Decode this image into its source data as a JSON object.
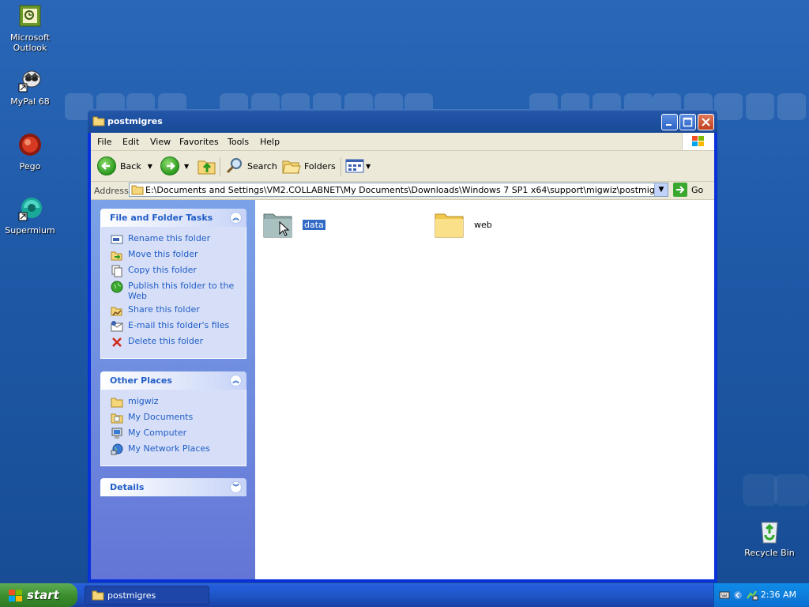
{
  "desktop": {
    "icons": [
      {
        "label": "Microsoft Outlook",
        "icon": "outlook-icon"
      },
      {
        "label": "MyPal 68",
        "icon": "mypal-icon"
      },
      {
        "label": "Pego",
        "icon": "pego-icon"
      },
      {
        "label": "Supermium",
        "icon": "supermium-icon"
      },
      {
        "label": "Recycle Bin",
        "icon": "recycle-bin-icon"
      }
    ]
  },
  "window": {
    "title": "postmigres",
    "menu": [
      "File",
      "Edit",
      "View",
      "Favorites",
      "Tools",
      "Help"
    ],
    "toolbar": {
      "back": "Back",
      "search": "Search",
      "folders": "Folders"
    },
    "address": {
      "label": "Address",
      "path": "E:\\Documents and Settings\\VM2.COLLABNET\\My Documents\\Downloads\\Windows 7 SP1 x64\\support\\migwiz\\postmigres",
      "go": "Go"
    },
    "tasks": {
      "title": "File and Folder Tasks",
      "items": [
        "Rename this folder",
        "Move this folder",
        "Copy this folder",
        "Publish this folder to the Web",
        "Share this folder",
        "E-mail this folder's files",
        "Delete this folder"
      ]
    },
    "other_places": {
      "title": "Other Places",
      "items": [
        "migwiz",
        "My Documents",
        "My Computer",
        "My Network Places"
      ]
    },
    "details": {
      "title": "Details"
    },
    "files": [
      {
        "name": "data",
        "selected": true
      },
      {
        "name": "web",
        "selected": false
      }
    ]
  },
  "taskbar": {
    "start": "start",
    "task": "postmigres",
    "clock": "2:36 AM"
  },
  "colors": {
    "title_blue": "#0831d9",
    "link_blue": "#215dc6",
    "selection": "#316ac5",
    "start_green": "#3c8f2e"
  }
}
